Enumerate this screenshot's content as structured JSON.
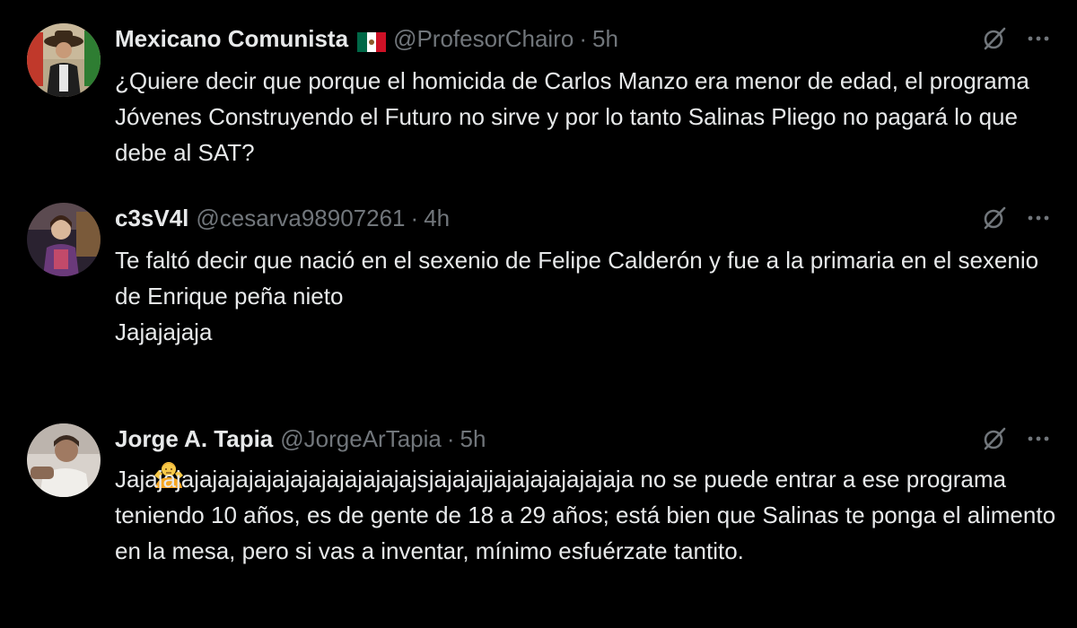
{
  "colors": {
    "background": "#000000",
    "primary_text": "#e7e9ea",
    "secondary_text": "#71767b"
  },
  "tweets": [
    {
      "name": "Mexicano Comunista",
      "handle": "@ProfesorChairo",
      "separator": "·",
      "time": "5h",
      "flag_icon": "mexico-flag-icon",
      "text": "¿Quiere decir que porque el homicida de Carlos Manzo era menor de edad, el programa Jóvenes Construyendo el Futuro no sirve y por lo tanto Salinas Pliego no pagará lo que debe al SAT?"
    },
    {
      "name": "c3sV4l",
      "handle": "@cesarva98907261",
      "separator": "·",
      "time": "4h",
      "lines": [
        "Te faltó decir que nació en el sexenio de Felipe Calderón y fue a la primaria en el sexenio de Enrique peña nieto",
        "Jajajajaja"
      ],
      "emoji_icon": "person-shrugging-emoji-icon"
    },
    {
      "name": "Jorge A. Tapia",
      "handle": "@JorgeArTapia",
      "separator": "·",
      "time": "5h",
      "text": "Jajajajajajajajajajajajajajajajajsjajajajjajajajajajajaja no se puede entrar a ese programa teniendo 10 años, es de gente de 18 a 29 años; está bien que Salinas te ponga el alimento en la mesa, pero si vas a inventar, mínimo esfuérzate tantito."
    }
  ]
}
